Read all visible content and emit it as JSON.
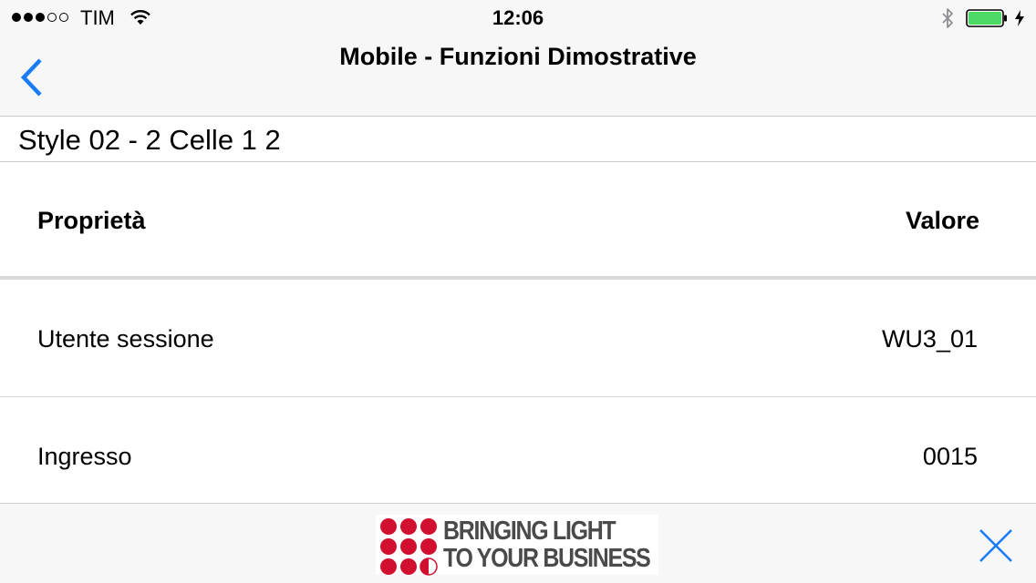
{
  "status_bar": {
    "carrier": "TIM",
    "time": "12:06",
    "signal_bars": 3,
    "signal_total": 5,
    "battery_level": 1.0,
    "battery_color": "#4cd964",
    "icons": [
      "wifi-icon",
      "bluetooth-icon",
      "battery-icon",
      "charging-icon"
    ]
  },
  "nav": {
    "title": "Mobile - Funzioni Dimostrative",
    "back_icon": "chevron-left-icon",
    "accent_color": "#1a7cf5"
  },
  "section": {
    "title": "Style 02 - 2 Celle 1 2"
  },
  "table": {
    "headers": {
      "property": "Proprietà",
      "value": "Valore"
    },
    "rows": [
      {
        "property": "Utente sessione",
        "value": "WU3_01"
      },
      {
        "property": "Ingresso",
        "value": "0015"
      }
    ]
  },
  "footer": {
    "banner_line1": "BRINGING LIGHT",
    "banner_line2": "TO YOUR BUSINESS",
    "logo_color": "#d0102e",
    "close_icon": "close-icon"
  }
}
